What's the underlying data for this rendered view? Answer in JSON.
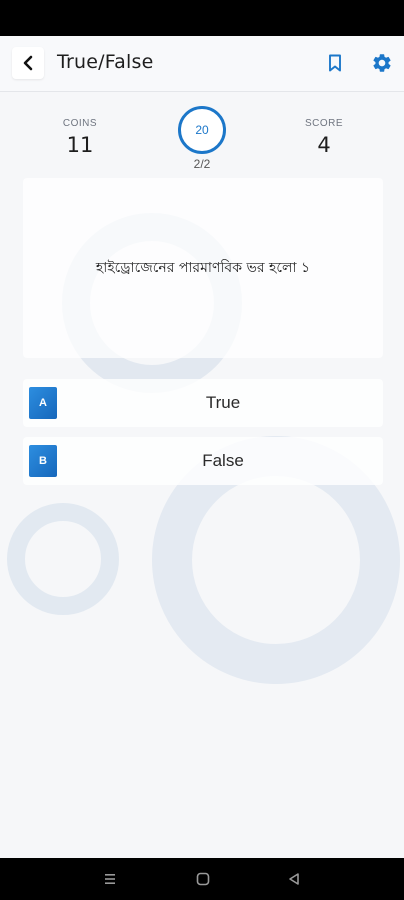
{
  "app_bar": {
    "title": "True/False",
    "icons": {
      "back": "chevron-left-icon",
      "bookmark": "bookmark-icon",
      "settings": "gear-icon"
    },
    "accent_color": "#1c77c9"
  },
  "stats": {
    "coins": {
      "label": "COINS",
      "value": "11"
    },
    "score": {
      "label": "SCORE",
      "value": "4"
    },
    "timer": {
      "value": "20"
    },
    "progress": "2/2"
  },
  "question": {
    "text": "হাইড্রোজেনের পারমাণবিক ভর হলো ১"
  },
  "options": [
    {
      "letter": "A",
      "label": "True"
    },
    {
      "letter": "B",
      "label": "False"
    }
  ],
  "nav_bar": {
    "icons": {
      "recents": "recents-icon",
      "home": "home-icon",
      "back": "back-triangle-icon"
    }
  }
}
